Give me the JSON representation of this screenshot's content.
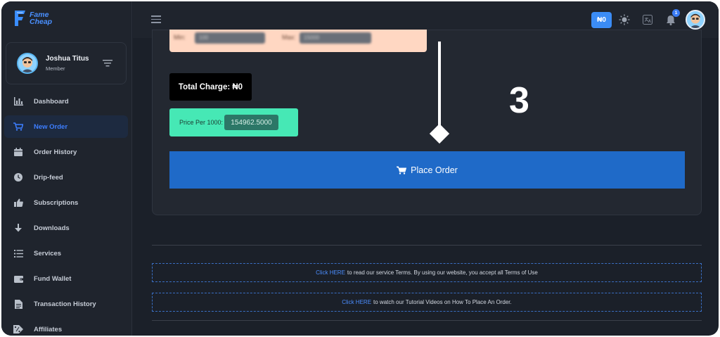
{
  "brand": {
    "line1": "Fame",
    "line2": "Cheap",
    "color": "#4a90ff"
  },
  "user": {
    "name": "Joshua Titus",
    "role": "Member"
  },
  "nav": {
    "items": [
      {
        "label": "Dashboard",
        "icon": "chart-icon"
      },
      {
        "label": "New Order",
        "icon": "cart-icon",
        "active": true
      },
      {
        "label": "Order History",
        "icon": "calendar-icon"
      },
      {
        "label": "Drip-feed",
        "icon": "clock-icon"
      },
      {
        "label": "Subscriptions",
        "icon": "thumbs-up-icon"
      },
      {
        "label": "Downloads",
        "icon": "arrow-down-icon"
      },
      {
        "label": "Services",
        "icon": "list-icon"
      },
      {
        "label": "Fund Wallet",
        "icon": "wallet-icon"
      },
      {
        "label": "Transaction History",
        "icon": "file-icon"
      },
      {
        "label": "Affiliates",
        "icon": "percent-icon"
      }
    ]
  },
  "topbar": {
    "wallet_balance": "₦0",
    "notification_count": "1"
  },
  "order": {
    "min_label": "Min:",
    "min_value": "100",
    "max_label": "Max:",
    "max_value": "15000",
    "total_charge": "Total Charge: ₦0",
    "price_label": "Price Per 1000:",
    "price_value": "154962.5000",
    "place_order_label": "Place Order"
  },
  "annotation": {
    "step": "3"
  },
  "info": {
    "terms_link": "Click HERE",
    "terms_text": "to read our service Terms. By using our website, you accept all Terms of Use",
    "tutorial_link": "Click HERE",
    "tutorial_text": "to watch our Tutorial Videos on How To Place An Order."
  },
  "colors": {
    "accent": "#1f6ac8",
    "active_nav": "#3d7eff",
    "price_box": "#46e8b5",
    "min_max_box": "#ffd7c2"
  }
}
